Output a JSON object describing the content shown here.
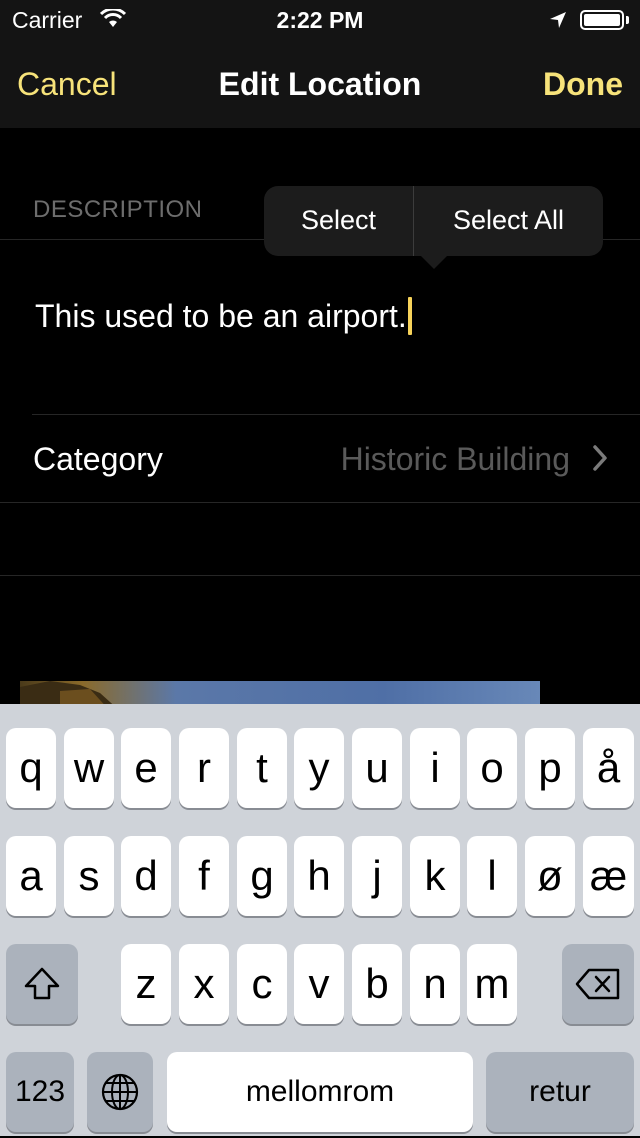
{
  "status_bar": {
    "carrier": "Carrier",
    "time": "2:22 PM"
  },
  "nav": {
    "cancel": "Cancel",
    "title": "Edit Location",
    "done": "Done"
  },
  "description": {
    "header": "DESCRIPTION",
    "text": "This used to be an airport."
  },
  "edit_menu": {
    "select": "Select",
    "select_all": "Select All"
  },
  "category": {
    "label": "Category",
    "value": "Historic Building"
  },
  "keyboard": {
    "row1": [
      "q",
      "w",
      "e",
      "r",
      "t",
      "y",
      "u",
      "i",
      "o",
      "p",
      "å"
    ],
    "row2": [
      "a",
      "s",
      "d",
      "f",
      "g",
      "h",
      "j",
      "k",
      "l",
      "ø",
      "æ"
    ],
    "row3": [
      "z",
      "x",
      "c",
      "v",
      "b",
      "n",
      "m"
    ],
    "numbers": "123",
    "space": "mellomrom",
    "return": "retur"
  },
  "colors": {
    "accent": "#f7e37a",
    "caret": "#f7d35a",
    "background": "#000000",
    "nav_background": "#141414"
  }
}
